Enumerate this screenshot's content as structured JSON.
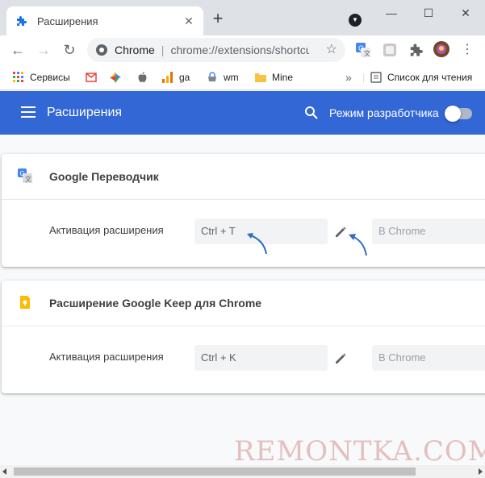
{
  "tab": {
    "title": "Расширения"
  },
  "toolbar": {
    "omnibox_site": "Chrome",
    "omnibox_url": "chrome://extensions/shortcuts"
  },
  "bookmarks": {
    "items": [
      "Сервисы",
      "ga",
      "wm",
      "Mine"
    ],
    "more": "»",
    "reading_list": "Список для чтения"
  },
  "header": {
    "title": "Расширения",
    "dev_mode_label": "Режим разработчика",
    "dev_mode_on": false
  },
  "extensions": [
    {
      "name": "Google Переводчик",
      "action_label": "Активация расширения",
      "shortcut": "Ctrl + T",
      "scope": "В Chrome"
    },
    {
      "name": "Расширение Google Keep для Chrome",
      "action_label": "Активация расширения",
      "shortcut": "Ctrl + K",
      "scope": "В Chrome"
    }
  ],
  "watermark": "REMONTKA.COM",
  "colors": {
    "header": "#3367d6",
    "annotation_arrow": "#2f6fbf"
  }
}
